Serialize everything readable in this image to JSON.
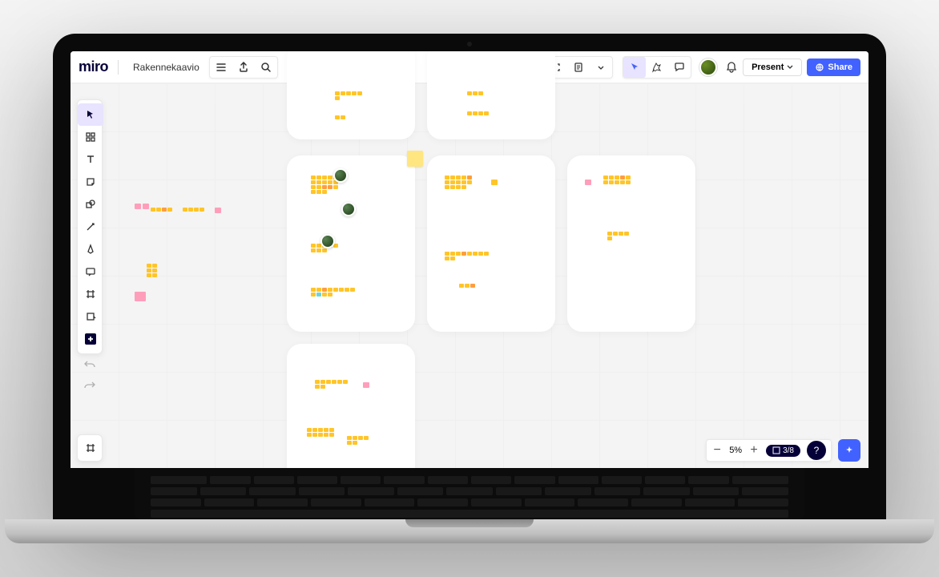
{
  "app": {
    "logo": "miro",
    "board_title": "Rakennekaavio"
  },
  "topbar_right": {
    "present_label": "Present",
    "share_label": "Share"
  },
  "tools": [
    {
      "id": "select",
      "label": "Select"
    },
    {
      "id": "template",
      "label": "Templates"
    },
    {
      "id": "text",
      "label": "Text"
    },
    {
      "id": "sticky",
      "label": "Sticky note"
    },
    {
      "id": "shape",
      "label": "Shape"
    },
    {
      "id": "line",
      "label": "Connection line"
    },
    {
      "id": "pen",
      "label": "Pen"
    },
    {
      "id": "comment",
      "label": "Comment"
    },
    {
      "id": "frame",
      "label": "Frame"
    },
    {
      "id": "upload",
      "label": "Upload"
    },
    {
      "id": "more",
      "label": "More apps"
    }
  ],
  "zoom": {
    "level": "5%",
    "frame_index": "3/8"
  },
  "frames_count": 8,
  "collaborator_cursors": 3
}
